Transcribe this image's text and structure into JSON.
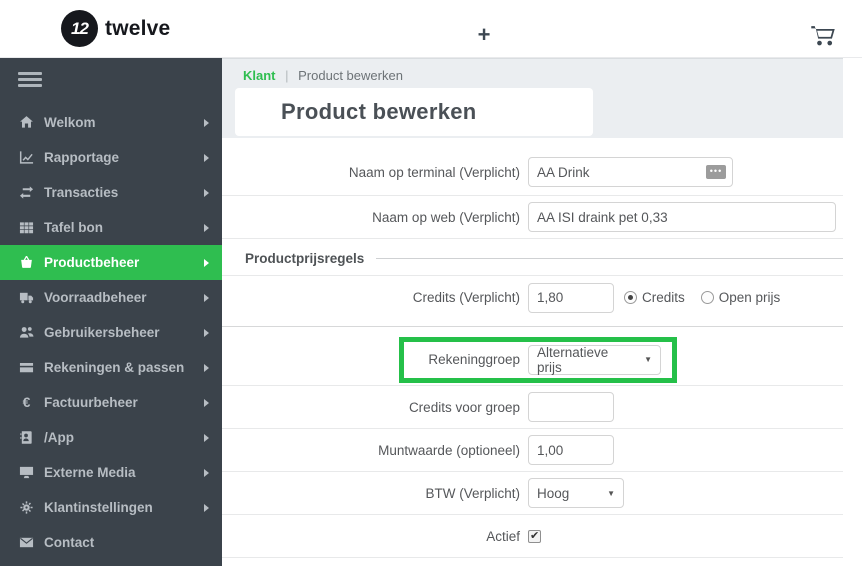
{
  "colors": {
    "accent_green": "#2fbe50",
    "annotation_green": "#25c049",
    "sidebar_bg": "#3b434b",
    "band_bg": "#ebeef1"
  },
  "topbar": {
    "logo_badge": "12",
    "logo_text": "twelve",
    "plus_label": "+"
  },
  "sidebar": {
    "items": [
      {
        "label": "Welkom",
        "icon": "home",
        "active": false,
        "has_submenu": true
      },
      {
        "label": "Rapportage",
        "icon": "chart-line",
        "active": false,
        "has_submenu": true
      },
      {
        "label": "Transacties",
        "icon": "exchange-arrows",
        "active": false,
        "has_submenu": true
      },
      {
        "label": "Tafel bon",
        "icon": "table-grid",
        "active": false,
        "has_submenu": true
      },
      {
        "label": "Productbeheer",
        "icon": "shopping-basket",
        "active": true,
        "has_submenu": true
      },
      {
        "label": "Voorraadbeheer",
        "icon": "truck",
        "active": false,
        "has_submenu": true
      },
      {
        "label": "Gebruikersbeheer",
        "icon": "users",
        "active": false,
        "has_submenu": true
      },
      {
        "label": "Rekeningen & passen",
        "icon": "credit-card",
        "active": false,
        "has_submenu": true
      },
      {
        "label": "Factuurbeheer",
        "icon": "euro",
        "active": false,
        "has_submenu": true
      },
      {
        "label": "/App",
        "icon": "address-book",
        "active": false,
        "has_submenu": true
      },
      {
        "label": "Externe Media",
        "icon": "desktop",
        "active": false,
        "has_submenu": true
      },
      {
        "label": "Klantinstellingen",
        "icon": "gears",
        "active": false,
        "has_submenu": true
      },
      {
        "label": "Contact",
        "icon": "envelope",
        "active": false,
        "has_submenu": false
      }
    ],
    "euro_glyph": "€"
  },
  "breadcrumb": {
    "section": "Klant",
    "separator": "|",
    "page": "Product bewerken"
  },
  "page": {
    "title": "Product bewerken"
  },
  "form": {
    "naam_terminal": {
      "label": "Naam op terminal (Verplicht)",
      "value": "AA Drink",
      "helper_icon_glyph": "•••"
    },
    "naam_web": {
      "label": "Naam op web (Verplicht)",
      "value": "AA ISI draink pet 0,33"
    },
    "section_title": "Productprijsregels",
    "credits": {
      "label": "Credits (Verplicht)",
      "value": "1,80",
      "radios": [
        {
          "label": "Credits",
          "checked": true
        },
        {
          "label": "Open prijs",
          "checked": false
        }
      ]
    },
    "rekeninggroep": {
      "label": "Rekeninggroep",
      "selected": "Alternatieve prijs",
      "caret": "▼",
      "highlighted": true
    },
    "credits_groep": {
      "label": "Credits voor groep",
      "value": ""
    },
    "muntwaarde": {
      "label": "Muntwaarde (optioneel)",
      "value": "1,00"
    },
    "btw": {
      "label": "BTW (Verplicht)",
      "selected": "Hoog",
      "caret": "▼"
    },
    "actief": {
      "label": "Actief",
      "checked": true
    }
  }
}
